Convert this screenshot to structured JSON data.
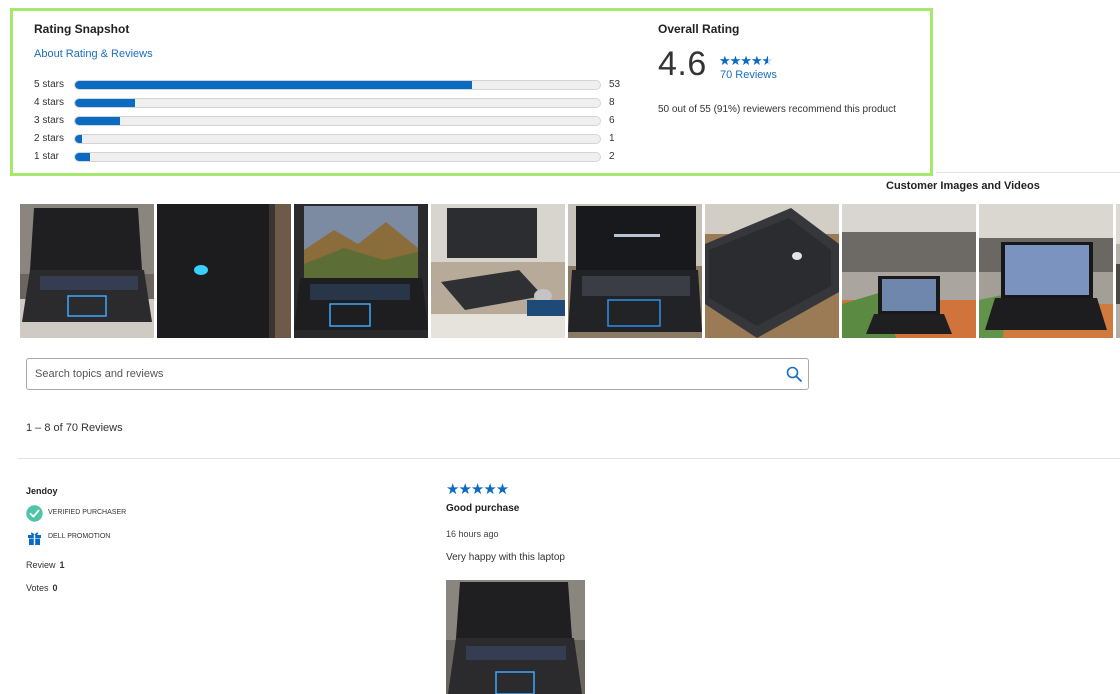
{
  "snapshot": {
    "title": "Rating Snapshot",
    "about_link": "About Rating & Reviews",
    "bars": [
      {
        "label": "5 stars",
        "count": "53",
        "fraction": 0.757
      },
      {
        "label": "4 stars",
        "count": "8",
        "fraction": 0.114
      },
      {
        "label": "3 stars",
        "count": "6",
        "fraction": 0.086
      },
      {
        "label": "2 stars",
        "count": "1",
        "fraction": 0.014
      },
      {
        "label": "1 star",
        "count": "2",
        "fraction": 0.029
      }
    ]
  },
  "overall": {
    "title": "Overall Rating",
    "value": "4.6",
    "stars": "★★★★★",
    "star_fraction": 0.92,
    "reviews_link": "70 Reviews",
    "recommend_text": "50 out of 55 (91%) reviewers recommend this product"
  },
  "customer_media": {
    "title": "Customer Images and Videos"
  },
  "search": {
    "placeholder": "Search topics and reviews"
  },
  "reviews_count_text": "1 – 8 of 70 Reviews",
  "review": {
    "author": "Jendoy",
    "badges": [
      "VERIFIED PURCHASER",
      "DELL PROMOTION"
    ],
    "review_label": "Review",
    "review_count": "1",
    "votes_label": "Votes",
    "votes_count": "0",
    "stars": "★★★★★",
    "title": "Good purchase",
    "time": "16 hours ago",
    "body": "Very happy with this laptop"
  },
  "colors": {
    "accent": "#0a6bc2",
    "panel_border": "#a6e86a",
    "verified_badge": "#4fc3a6"
  }
}
